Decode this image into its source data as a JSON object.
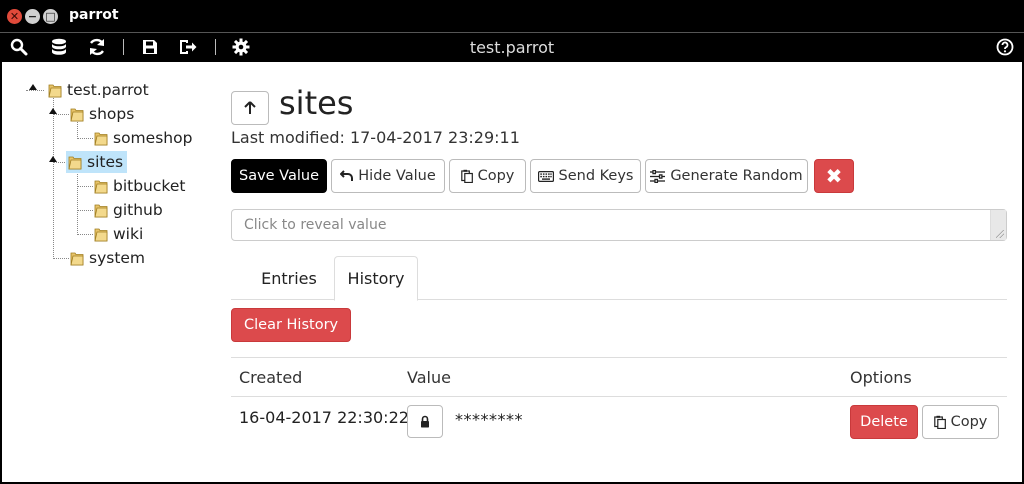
{
  "window": {
    "title": "parrot"
  },
  "toolbar": {
    "app_title": "test.parrot",
    "icons": [
      "search-icon",
      "database-icon",
      "refresh-icon",
      "save-icon",
      "logout-icon",
      "settings-icon",
      "help-icon"
    ]
  },
  "tree": {
    "root": "test.parrot",
    "nodes": [
      {
        "label": "shops"
      },
      {
        "label": "someshop"
      },
      {
        "label": "sites"
      },
      {
        "label": "bitbucket"
      },
      {
        "label": "github"
      },
      {
        "label": "wiki"
      },
      {
        "label": "system"
      }
    ],
    "selected": "sites"
  },
  "entry": {
    "title": "sites",
    "last_modified": "Last modified: 17-04-2017 23:29:11",
    "buttons": {
      "save": "Save Value",
      "hide": "Hide Value",
      "copy": "Copy",
      "send_keys": "Send Keys",
      "generate": "Generate Random",
      "delete": "✖"
    },
    "value_placeholder": "Click to reveal value"
  },
  "tabs": [
    {
      "label": "Entries"
    },
    {
      "label": "History"
    }
  ],
  "active_tab": "History",
  "history": {
    "clear_label": "Clear History",
    "columns": [
      "Created",
      "Value",
      "Options"
    ],
    "rows": [
      {
        "created": "16-04-2017 22:30:22",
        "value": "********",
        "delete": "Delete",
        "copy": "Copy"
      }
    ]
  },
  "colors": {
    "danger": "#dc4a4c",
    "selected": "#bfe4fa",
    "frame": "#000000"
  }
}
